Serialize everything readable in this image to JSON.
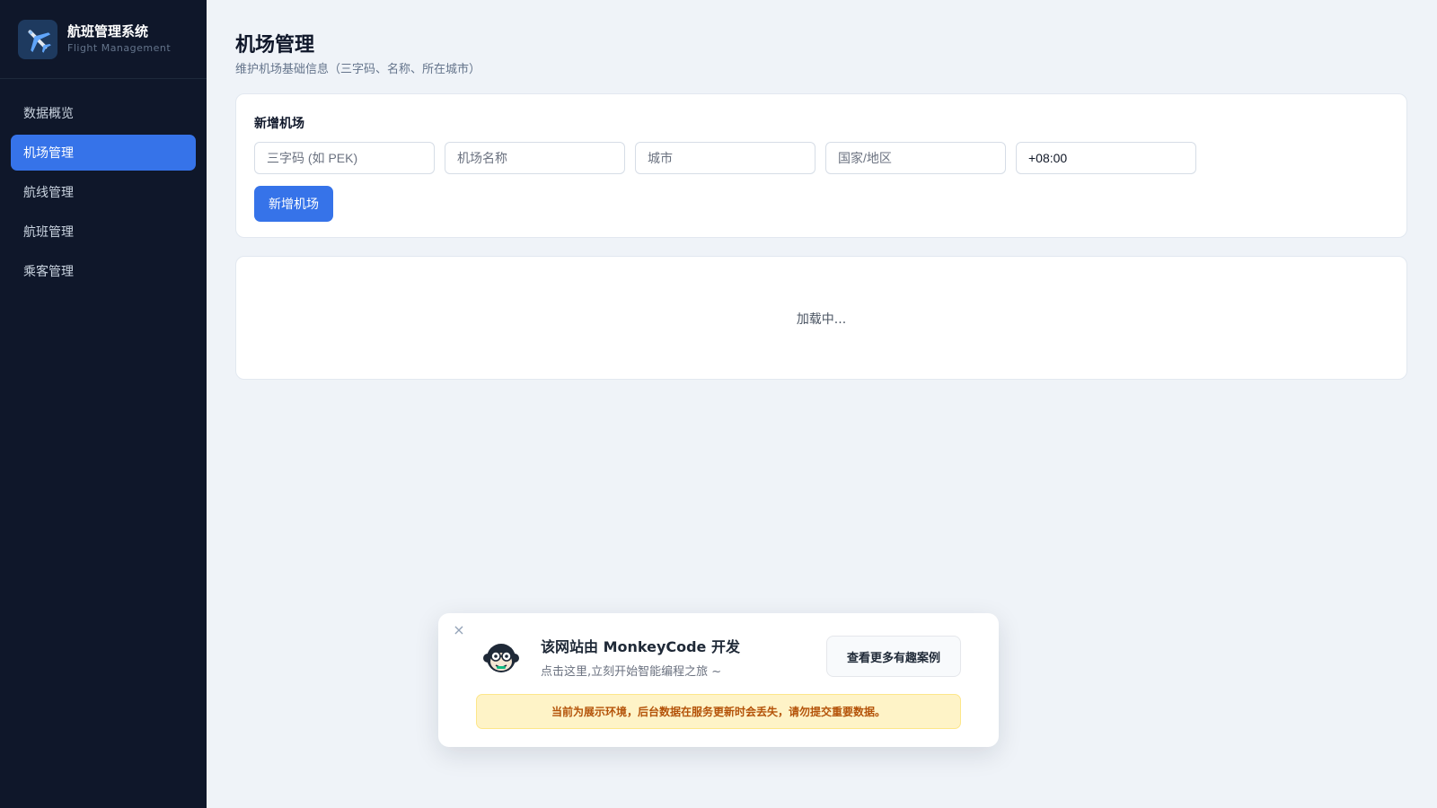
{
  "brand": {
    "title": "航班管理系统",
    "subtitle": "Flight Management",
    "logo_icon": "airplane-icon"
  },
  "sidebar": {
    "items": [
      {
        "label": "数据概览",
        "active": false
      },
      {
        "label": "机场管理",
        "active": true
      },
      {
        "label": "航线管理",
        "active": false
      },
      {
        "label": "航班管理",
        "active": false
      },
      {
        "label": "乘客管理",
        "active": false
      }
    ]
  },
  "page": {
    "title": "机场管理",
    "subtitle": "维护机场基础信息（三字码、名称、所在城市）"
  },
  "form": {
    "title": "新增机场",
    "fields": [
      {
        "placeholder": "三字码 (如 PEK)",
        "value": ""
      },
      {
        "placeholder": "机场名称",
        "value": ""
      },
      {
        "placeholder": "城市",
        "value": ""
      },
      {
        "placeholder": "国家/地区",
        "value": ""
      },
      {
        "placeholder": "",
        "value": "+08:00"
      }
    ],
    "submit_label": "新增机场"
  },
  "list": {
    "loading_text": "加载中..."
  },
  "promo": {
    "close_glyph": "×",
    "avatar_icon": "monkey-icon",
    "title": "该网站由 MonkeyCode 开发",
    "description": "点击这里,立刻开始智能编程之旅 ~",
    "button_label": "查看更多有趣案例",
    "warning": "当前为展示环境，后台数据在服务更新时会丢失，请勿提交重要数据。"
  },
  "colors": {
    "sidebar_bg": "#0f172a",
    "accent": "#3673e9",
    "page_bg": "#eff3f8",
    "warning_bg": "#fef3c7",
    "warning_text": "#b45309"
  }
}
